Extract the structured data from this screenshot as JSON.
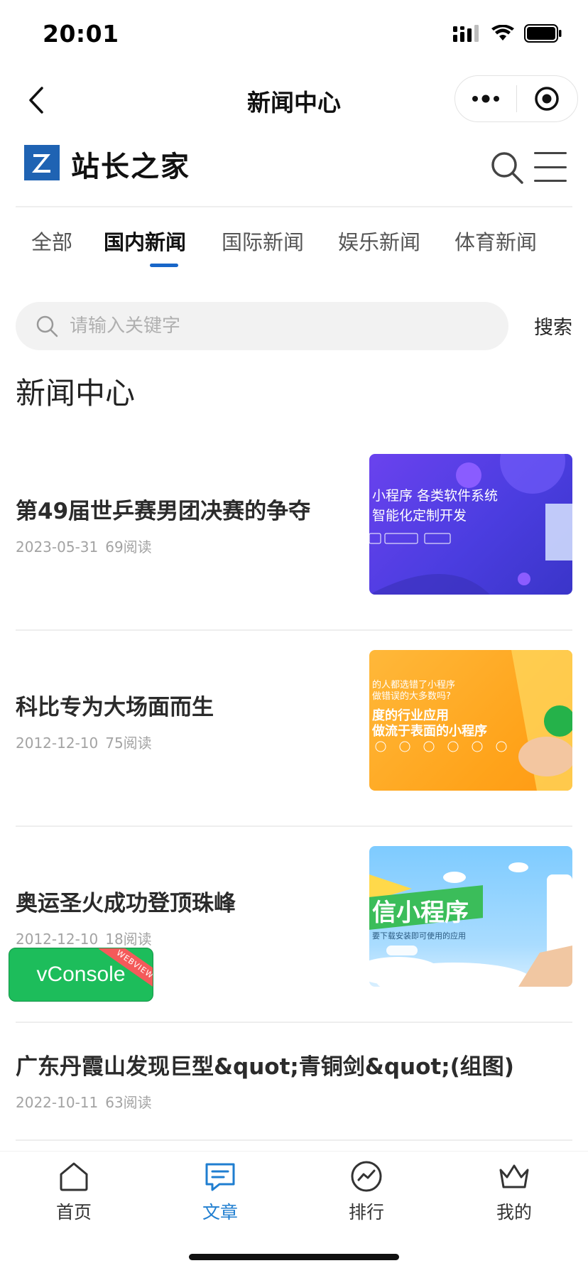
{
  "status_bar": {
    "time": "20:01"
  },
  "nav": {
    "title": "新闻中心"
  },
  "site": {
    "logo_text": "站长之家"
  },
  "tabs": [
    {
      "label": "全部",
      "active": false
    },
    {
      "label": "国内新闻",
      "active": true
    },
    {
      "label": "国际新闻",
      "active": false
    },
    {
      "label": "娱乐新闻",
      "active": false
    },
    {
      "label": "体育新闻",
      "active": false
    }
  ],
  "search": {
    "placeholder": "请输入关键字",
    "button_label": "搜索"
  },
  "section_title": "新闻中心",
  "news": [
    {
      "title": "第49届世乒赛男团决赛的争夺",
      "date": "2023-05-31",
      "reads": "69阅读",
      "thumb_lines": [
        "小程序 各类软件系统",
        "智能化定制开发"
      ]
    },
    {
      "title": "科比专为大场面而生",
      "date": "2012-12-10",
      "reads": "75阅读",
      "thumb_lines": [
        "的人都选错了小程序",
        "做错误的大多数吗?",
        "度的行业应用",
        "做流于表面的小程序"
      ]
    },
    {
      "title": "奥运圣火成功登顶珠峰",
      "date": "2012-12-10",
      "reads": "18阅读",
      "thumb_lines": [
        "信小程序",
        "要下载安装即可使用的应用"
      ]
    },
    {
      "title": "广东丹霞山发现巨型&quot;青铜剑&quot;(组图)",
      "date": "2022-10-11",
      "reads": "63阅读"
    }
  ],
  "vconsole": {
    "label": "vConsole",
    "ribbon": "WEBVIEW"
  },
  "tab_bar": [
    {
      "label": "首页",
      "icon": "home-icon",
      "active": false
    },
    {
      "label": "文章",
      "icon": "article-icon",
      "active": true
    },
    {
      "label": "排行",
      "icon": "ranking-icon",
      "active": false
    },
    {
      "label": "我的",
      "icon": "crown-icon",
      "active": false
    }
  ],
  "colors": {
    "accent": "#1866c8",
    "tab_active": "#1f7ed0",
    "vconsole": "#1dbd5b"
  }
}
